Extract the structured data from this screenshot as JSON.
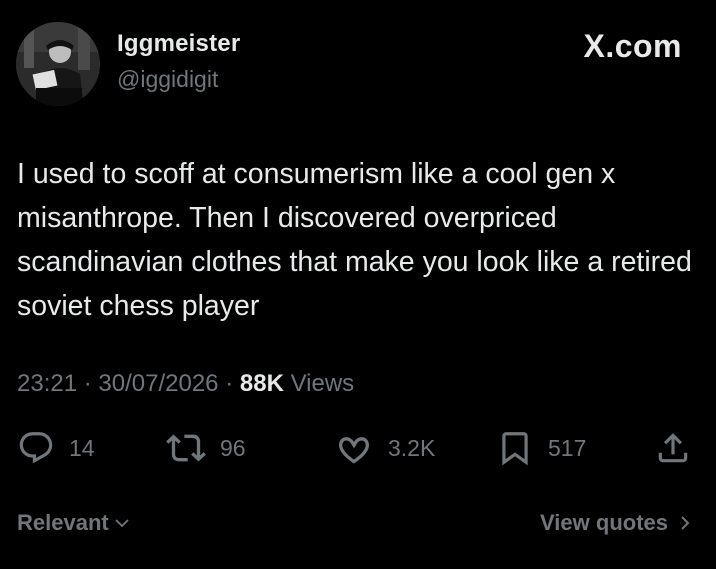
{
  "post": {
    "display_name": "Iggmeister",
    "handle": "@iggidigit",
    "site_label": "X.com",
    "text": "I used to scoff at consumerism like a cool gen x misanthrope. Then I discovered overpriced scandinavian clothes that make you look like a retired soviet chess player",
    "time": "23:21",
    "separator": "·",
    "date": "30/07/2026",
    "views_count": "88K",
    "views_label": "Views"
  },
  "actions": {
    "replies": "14",
    "reposts": "96",
    "likes": "3.2K",
    "bookmarks": "517"
  },
  "footer": {
    "sort_label": "Relevant",
    "view_quotes_label": "View quotes"
  },
  "icons": {
    "reply": "reply-icon",
    "repost": "repost-icon",
    "like": "heart-icon",
    "bookmark": "bookmark-icon",
    "share": "share-icon",
    "chevron_down": "chevron-down-icon",
    "chevron_right": "chevron-right-icon"
  },
  "colors": {
    "background": "#000000",
    "primary_text": "#e7e9ea",
    "secondary_text": "#71767b"
  }
}
